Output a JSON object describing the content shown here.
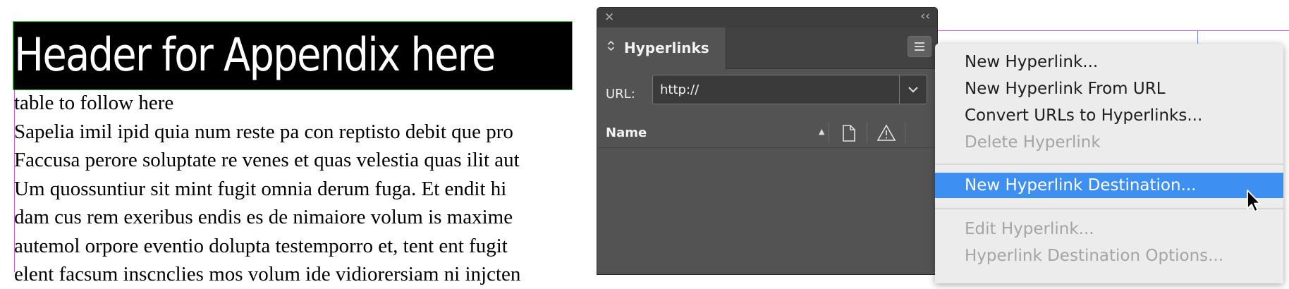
{
  "document": {
    "header": "Header for Appendix here",
    "lines": [
      "table to follow here",
      "Sapelia imil ipid quia num reste pa con reptisto debit que pro",
      "Faccusa perore soluptate re venes et quas velestia quas ilit aut",
      "Um quossuntiur sit mint fugit omnia derum fuga. Et endit hi",
      "dam cus rem exeribus endis es de nimaiore volum is maxime",
      "autemol orpore eventio dolupta testemporro et, tent ent fugit",
      "elent facsum inscnclies mos volum ide vidiorersiam ni injcten"
    ]
  },
  "panel": {
    "close_glyph": "×",
    "collapse_glyph": "‹‹",
    "tab_label": "Hyperlinks",
    "url_label": "URL:",
    "url_value": "http://",
    "column_name": "Name",
    "icons": [
      "page-icon",
      "warning-icon",
      "panel-menu-icon",
      "chevron-down-icon"
    ]
  },
  "menu": {
    "items": [
      {
        "label": "New Hyperlink...",
        "state": "enabled"
      },
      {
        "label": "New Hyperlink From URL",
        "state": "enabled"
      },
      {
        "label": "Convert URLs to Hyperlinks...",
        "state": "enabled"
      },
      {
        "label": "Delete Hyperlink",
        "state": "disabled"
      },
      {
        "label": "New Hyperlink Destination...",
        "state": "selected"
      },
      {
        "label": "Edit Hyperlink...",
        "state": "disabled"
      },
      {
        "label": "Hyperlink Destination Options...",
        "state": "disabled"
      }
    ]
  },
  "colors": {
    "selection": "#3d8ff2",
    "panel_bg": "#535353",
    "guide": "#d45bd6",
    "frame": "#37c837"
  }
}
